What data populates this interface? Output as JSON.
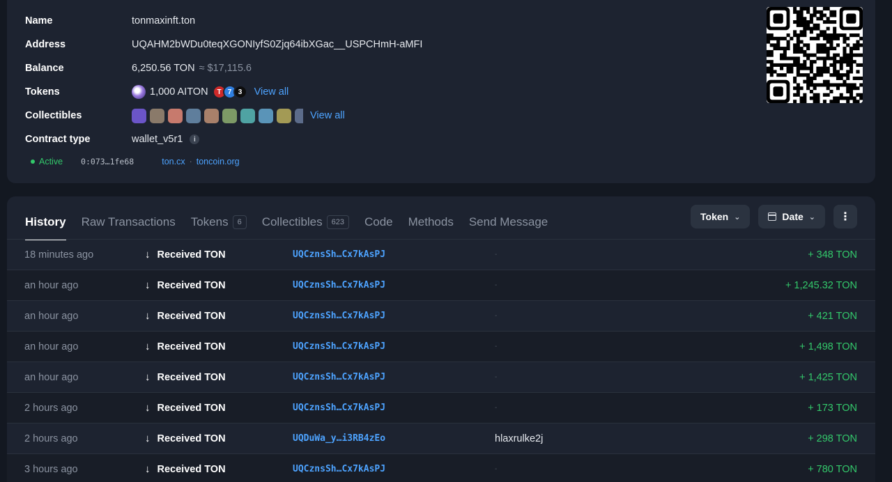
{
  "wallet": {
    "name_label": "Name",
    "name_value": "tonmaxinft.ton",
    "address_label": "Address",
    "address_value": "UQAHM2bWDu0teqXGONIyfS0Zjq64ibXGac__USPCHmH-aMFI",
    "balance_label": "Balance",
    "balance_value": "6,250.56 TON",
    "balance_usd": "≈ $17,115.6",
    "tokens_label": "Tokens",
    "tokens_value": "1,000 AITON",
    "tokens_view_all": "View all",
    "collectibles_label": "Collectibles",
    "collectibles_view_all": "View all",
    "contract_label": "Contract type",
    "contract_value": "wallet_v5r1",
    "status": "Active",
    "raw_address": "0:073…1fe68",
    "explorer_link_1": "ton.cx",
    "explorer_link_2": "toncoin.org",
    "link_separator": "·"
  },
  "tabs": [
    {
      "label": "History",
      "active": true
    },
    {
      "label": "Raw Transactions"
    },
    {
      "label": "Tokens",
      "count": "6"
    },
    {
      "label": "Collectibles",
      "count": "623"
    },
    {
      "label": "Code"
    },
    {
      "label": "Methods"
    },
    {
      "label": "Send Message"
    }
  ],
  "filters": {
    "token_label": "Token",
    "date_label": "Date",
    "more_label": "⋮"
  },
  "transactions": [
    {
      "time": "18 minutes ago",
      "action": "Received TON",
      "from": "UQCznsSh…Cx7kAsPJ",
      "comment": "-",
      "amount": "+ 348 TON"
    },
    {
      "time": "an hour ago",
      "action": "Received TON",
      "from": "UQCznsSh…Cx7kAsPJ",
      "comment": "-",
      "amount": "+ 1,245.32 TON"
    },
    {
      "time": "an hour ago",
      "action": "Received TON",
      "from": "UQCznsSh…Cx7kAsPJ",
      "comment": "-",
      "amount": "+ 421 TON"
    },
    {
      "time": "an hour ago",
      "action": "Received TON",
      "from": "UQCznsSh…Cx7kAsPJ",
      "comment": "-",
      "amount": "+ 1,498 TON"
    },
    {
      "time": "an hour ago",
      "action": "Received TON",
      "from": "UQCznsSh…Cx7kAsPJ",
      "comment": "-",
      "amount": "+ 1,425 TON"
    },
    {
      "time": "2 hours ago",
      "action": "Received TON",
      "from": "UQCznsSh…Cx7kAsPJ",
      "comment": "-",
      "amount": "+ 173 TON"
    },
    {
      "time": "2 hours ago",
      "action": "Received TON",
      "from": "UQDuWa_y…i3RB4zEo",
      "comment": "hlaxrulke2j",
      "amount": "+ 298 TON"
    },
    {
      "time": "3 hours ago",
      "action": "Received TON",
      "from": "UQCznsSh…Cx7kAsPJ",
      "comment": "-",
      "amount": "+ 780 TON"
    }
  ]
}
